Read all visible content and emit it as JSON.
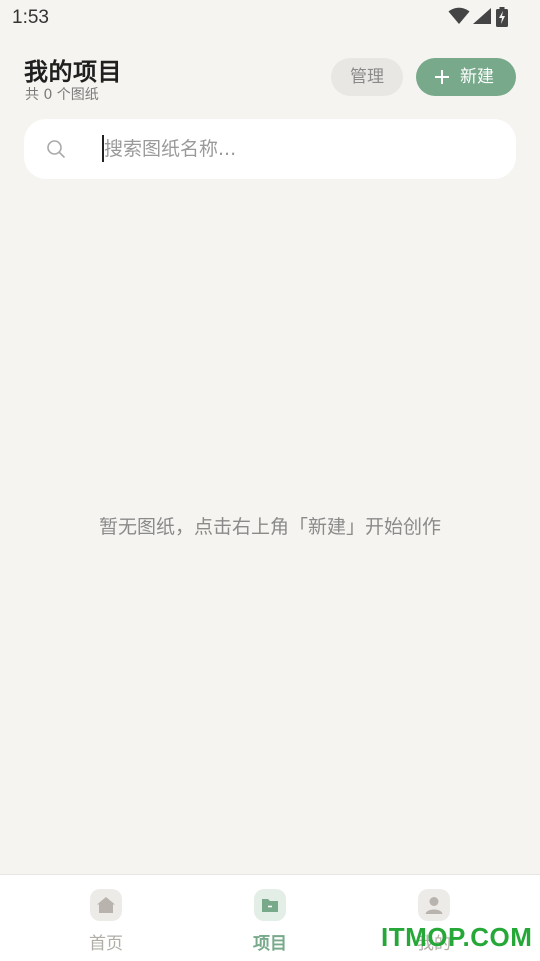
{
  "status_bar": {
    "time": "1:53",
    "icons": [
      "wifi-icon",
      "cellular-signal-icon",
      "battery-charging-icon"
    ]
  },
  "header": {
    "title": "我的项目",
    "subtitle": "共 0 个图纸",
    "manage_label": "管理",
    "new_label": "新建"
  },
  "search": {
    "placeholder": "搜索图纸名称...",
    "value": ""
  },
  "empty_state": {
    "message": "暂无图纸，点击右上角「新建」开始创作"
  },
  "tabs": [
    {
      "label": "首页",
      "icon": "home-icon",
      "active": false
    },
    {
      "label": "项目",
      "icon": "folder-icon",
      "active": true
    },
    {
      "label": "我的",
      "icon": "user-icon",
      "active": false
    }
  ],
  "watermark": "ITMOP.COM",
  "colors": {
    "accent": "#77a98a",
    "background": "#f5f4f0",
    "inactive_tab": "#b0aca6",
    "watermark": "#25a838"
  }
}
